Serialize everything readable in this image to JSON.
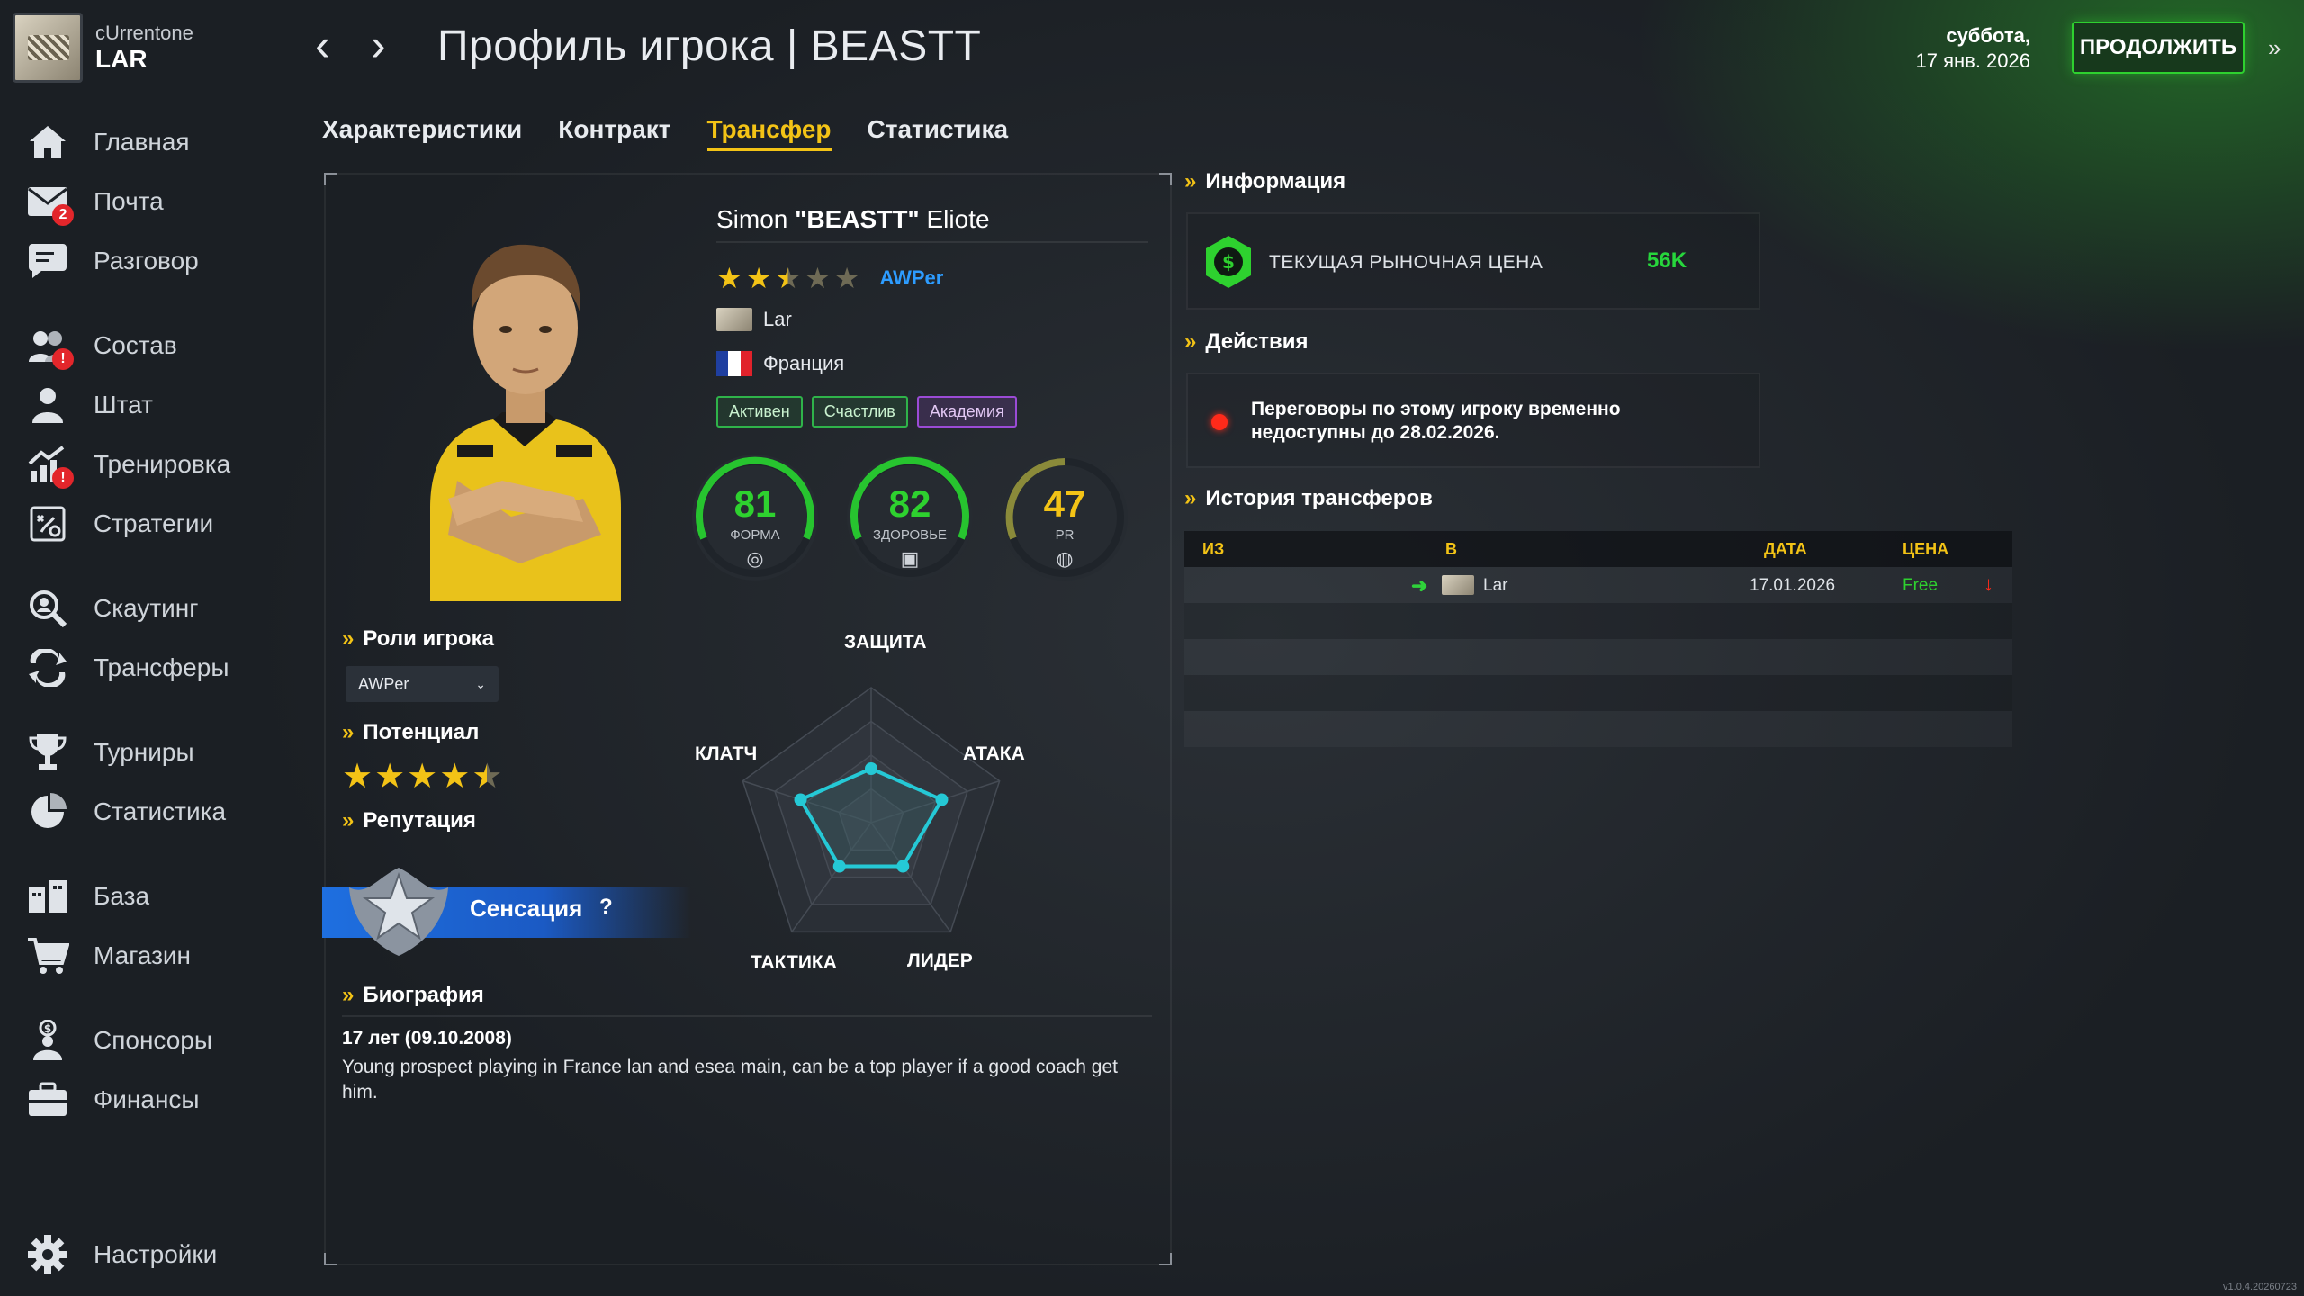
{
  "header": {
    "team_subtitle": "cUrrentone",
    "team_name": "LAR",
    "title": "Профиль игрока | BEASTT",
    "date_day": "суббота,",
    "date_full": "17 янв. 2026",
    "continue_label": "ПРОДОЛЖИТЬ"
  },
  "sidebar": {
    "items": [
      {
        "label": "Главная",
        "icon": "home-icon"
      },
      {
        "label": "Почта",
        "icon": "mail-icon",
        "badge": "2"
      },
      {
        "label": "Разговор",
        "icon": "chat-icon"
      },
      {
        "label": "Состав",
        "icon": "roster-icon",
        "badge": "!"
      },
      {
        "label": "Штат",
        "icon": "staff-icon"
      },
      {
        "label": "Тренировка",
        "icon": "training-icon",
        "badge": "!"
      },
      {
        "label": "Стратегии",
        "icon": "strategy-icon"
      },
      {
        "label": "Скаутинг",
        "icon": "scouting-icon"
      },
      {
        "label": "Трансферы",
        "icon": "transfers-icon"
      },
      {
        "label": "Турниры",
        "icon": "trophy-icon"
      },
      {
        "label": "Статистика",
        "icon": "pie-chart-icon"
      },
      {
        "label": "База",
        "icon": "base-icon"
      },
      {
        "label": "Магазин",
        "icon": "cart-icon"
      },
      {
        "label": "Спонсоры",
        "icon": "sponsor-icon"
      },
      {
        "label": "Финансы",
        "icon": "briefcase-icon"
      },
      {
        "label": "Настройки",
        "icon": "gear-icon"
      }
    ]
  },
  "tabs": [
    {
      "label": "Характеристики",
      "active": false
    },
    {
      "label": "Контракт",
      "active": false
    },
    {
      "label": "Трансфер",
      "active": true
    },
    {
      "label": "Статистика",
      "active": false
    }
  ],
  "player": {
    "first_name": "Simon",
    "nickname": "\"BEASTT\"",
    "last_name": "Eliote",
    "rating_stars": 2.5,
    "role": "AWPer",
    "team": "Lar",
    "country": "Франция",
    "tags": [
      "Активен",
      "Счастлив",
      "Академия"
    ],
    "form_value": "81",
    "form_label": "ФОРМА",
    "health_value": "82",
    "health_label": "ЗДОРОВЬЕ",
    "pr_value": "47",
    "pr_label": "PR"
  },
  "roles": {
    "heading": "Роли игрока",
    "selected": "AWPer"
  },
  "potential": {
    "heading": "Потенциал",
    "stars": 4.5
  },
  "reputation": {
    "heading": "Репутация",
    "label": "Сенсация",
    "help": "?"
  },
  "radar": {
    "labels": [
      "ЗАЩИТА",
      "АТАКА",
      "ЛИДЕР",
      "ТАКТИКА",
      "КЛАТЧ"
    ],
    "values": [
      0.4,
      0.55,
      0.4,
      0.4,
      0.55
    ]
  },
  "bio": {
    "heading": "Биография",
    "age": "17 лет (09.10.2008)",
    "text": "Young prospect playing in France lan and esea main, can be a top player if a good coach get him."
  },
  "info": {
    "heading": "Информация",
    "price_label": "ТЕКУЩАЯ РЫНОЧНАЯ ЦЕНА",
    "price_value": "56K"
  },
  "actions": {
    "heading": "Действия",
    "text": "Переговоры по этому игроку временно недоступны до 28.02.2026."
  },
  "history": {
    "heading": "История трансферов",
    "columns": [
      "ИЗ",
      "В",
      "ДАТА",
      "ЦЕНА"
    ],
    "rows": [
      {
        "from": "",
        "to": "Lar",
        "date": "17.01.2026",
        "price": "Free"
      }
    ]
  },
  "version": "v1.0.4.20260723",
  "colors": {
    "accent": "#f3c316",
    "green": "#2ed12f",
    "blue": "#2d9cff",
    "red": "#ff2a1a"
  }
}
